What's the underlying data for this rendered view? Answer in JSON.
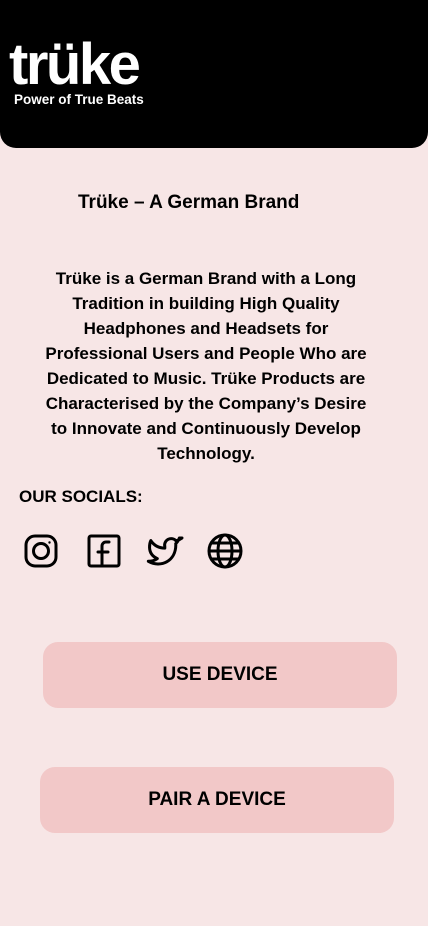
{
  "header": {
    "logo_text": "trüke",
    "tagline": "Power of True Beats"
  },
  "main": {
    "title": "Trüke – A German Brand",
    "description": "Trüke is a German Brand with a Long Tradition in building High Quality Headphones and Headsets for Professional Users and People Who are Dedicated to Music. Trüke Products are Characterised by the Company’s Desire to Innovate and Continuously Develop Technology.",
    "socials_label": "OUR SOCIALS:"
  },
  "socials": [
    {
      "icon": "instagram-icon"
    },
    {
      "icon": "facebook-icon"
    },
    {
      "icon": "twitter-icon"
    },
    {
      "icon": "globe-icon"
    }
  ],
  "buttons": {
    "use_device": "USE DEVICE",
    "pair_device": "PAIR A DEVICE"
  },
  "colors": {
    "background": "#f7e6e6",
    "header": "#000000",
    "button": "#f2c8c8"
  }
}
